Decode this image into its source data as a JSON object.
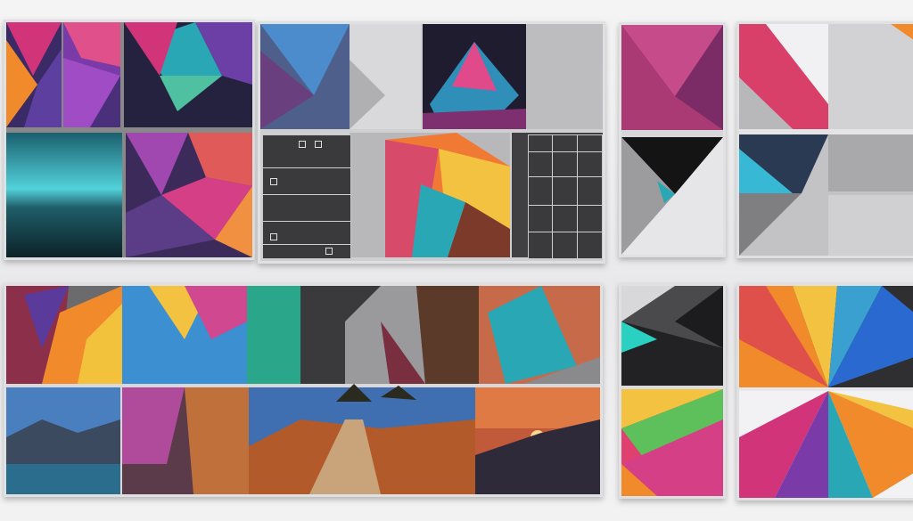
{
  "board": {
    "panels": [
      {
        "name": "panel-top-left"
      },
      {
        "name": "panel-top-center"
      },
      {
        "name": "panel-top-right-a"
      },
      {
        "name": "panel-top-right-b"
      },
      {
        "name": "panel-bottom-wide"
      },
      {
        "name": "panel-bottom-right-a"
      },
      {
        "name": "panel-bottom-right-b"
      }
    ]
  },
  "colors": {
    "background": "#efeff0",
    "frame": "#dfe0e2",
    "magenta": "#d2347a",
    "orange": "#f08a2a",
    "teal": "#2aa7b4",
    "violet": "#6c3fa6",
    "gray": "#9a9a9c"
  }
}
